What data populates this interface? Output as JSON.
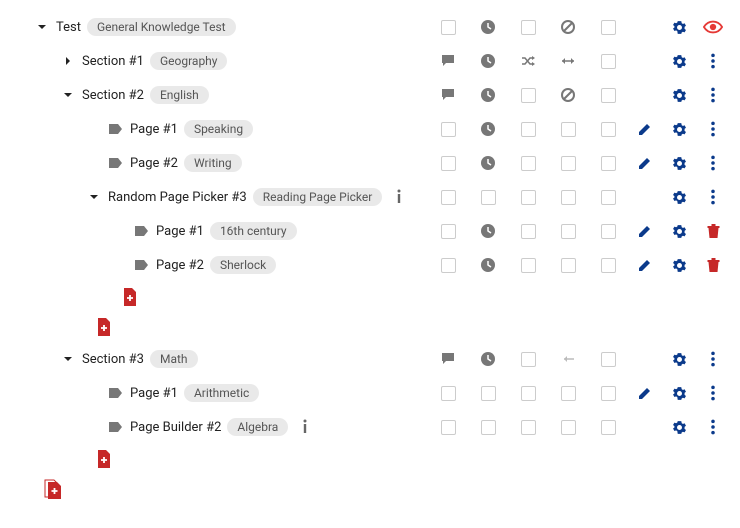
{
  "colors": {
    "navy": "#0b3a8b",
    "red": "#c62828",
    "gray": "#777"
  },
  "rows": [
    {
      "indent": 0,
      "caret": "down",
      "type": "none",
      "label": "Test",
      "chip": "General Knowledge Test",
      "status": [
        "box",
        "clock",
        "box",
        "ban",
        "box"
      ],
      "actions": [
        "gear",
        "eye-red"
      ]
    },
    {
      "indent": 1,
      "caret": "right",
      "type": "none",
      "label": "Section #1",
      "chip": "Geography",
      "status": [
        "chat",
        "clock",
        "shuffle",
        "h-arrow",
        "box"
      ],
      "actions": [
        "gear",
        "more"
      ]
    },
    {
      "indent": 1,
      "caret": "down",
      "type": "none",
      "label": "Section #2",
      "chip": "English",
      "status": [
        "chat",
        "clock",
        "box",
        "ban",
        "box"
      ],
      "actions": [
        "gear",
        "more"
      ]
    },
    {
      "indent": 2,
      "caret": "none",
      "type": "tag",
      "label": "Page #1",
      "chip": "Speaking",
      "status": [
        "box",
        "clock",
        "box",
        "box",
        "box"
      ],
      "actions": [
        "pencil",
        "gear",
        "more"
      ]
    },
    {
      "indent": 2,
      "caret": "none",
      "type": "tag",
      "label": "Page #2",
      "chip": "Writing",
      "status": [
        "box",
        "clock",
        "box",
        "box",
        "box"
      ],
      "actions": [
        "pencil",
        "gear",
        "more"
      ]
    },
    {
      "indent": 2,
      "caret": "down",
      "type": "none",
      "label": "Random Page Picker #3",
      "chip": "Reading Page Picker",
      "info": true,
      "status": [
        "box",
        "box",
        "box",
        "box",
        "box"
      ],
      "actions": [
        "gear",
        "more"
      ]
    },
    {
      "indent": 3,
      "caret": "none",
      "type": "tag",
      "label": "Page #1",
      "chip": "16th century",
      "status": [
        "box",
        "clock",
        "box",
        "box",
        "box"
      ],
      "actions": [
        "pencil",
        "gear",
        "trash"
      ]
    },
    {
      "indent": 3,
      "caret": "none",
      "type": "tag",
      "label": "Page #2",
      "chip": "Sherlock",
      "status": [
        "box",
        "clock",
        "box",
        "box",
        "box"
      ],
      "actions": [
        "pencil",
        "gear",
        "trash"
      ]
    },
    {
      "addAt": 3
    },
    {
      "addAt": 2
    },
    {
      "indent": 1,
      "caret": "down",
      "type": "none",
      "label": "Section #3",
      "chip": "Math",
      "status": [
        "chat",
        "clock",
        "box",
        "l-arrow",
        "box"
      ],
      "actions": [
        "gear",
        "more"
      ]
    },
    {
      "indent": 2,
      "caret": "none",
      "type": "tag",
      "label": "Page #1",
      "chip": "Arithmetic",
      "status": [
        "box",
        "box",
        "box",
        "box",
        "box"
      ],
      "actions": [
        "pencil",
        "gear",
        "more"
      ]
    },
    {
      "indent": 2,
      "caret": "none",
      "type": "tag",
      "label": "Page Builder #2",
      "chip": "Algebra",
      "info": true,
      "status": [
        "box",
        "box",
        "box",
        "box",
        "box"
      ],
      "actions": [
        "gear",
        "more"
      ]
    },
    {
      "addAt": 2
    },
    {
      "addMulti": 1
    }
  ]
}
